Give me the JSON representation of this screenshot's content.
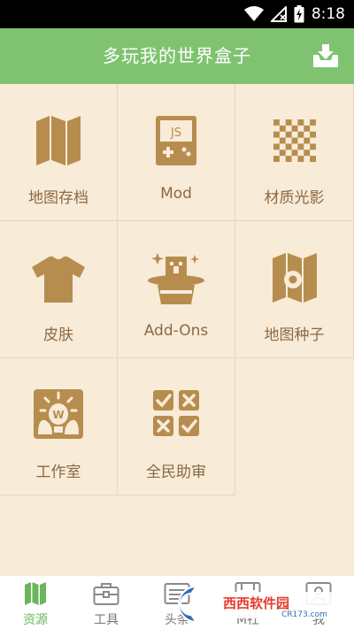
{
  "status": {
    "time": "8:18"
  },
  "header": {
    "title": "多玩我的世界盒子"
  },
  "grid": [
    {
      "label": "地图存档",
      "icon": "map-icon"
    },
    {
      "label": "Mod",
      "icon": "js-gamepad-icon"
    },
    {
      "label": "材质光影",
      "icon": "checker-texture-icon"
    },
    {
      "label": "皮肤",
      "icon": "shirt-icon"
    },
    {
      "label": "Add-Ons",
      "icon": "magic-hat-icon"
    },
    {
      "label": "地图种子",
      "icon": "seed-map-icon"
    },
    {
      "label": "工作室",
      "icon": "studio-icon"
    },
    {
      "label": "全民助审",
      "icon": "review-icon"
    }
  ],
  "nav": [
    {
      "label": "资源",
      "icon": "map-icon",
      "active": true
    },
    {
      "label": "工具",
      "icon": "toolbox-icon"
    },
    {
      "label": "头条",
      "icon": "news-icon"
    },
    {
      "label": "M社",
      "icon": "community-icon"
    },
    {
      "label": "我",
      "icon": "profile-icon"
    }
  ],
  "watermark": {
    "brand": "西西软件园",
    "url": "CR173.com"
  },
  "colors": {
    "accent": "#7fc371",
    "icon": "#b78d4f",
    "label": "#8a6a45",
    "background": "#f8ebd8"
  }
}
